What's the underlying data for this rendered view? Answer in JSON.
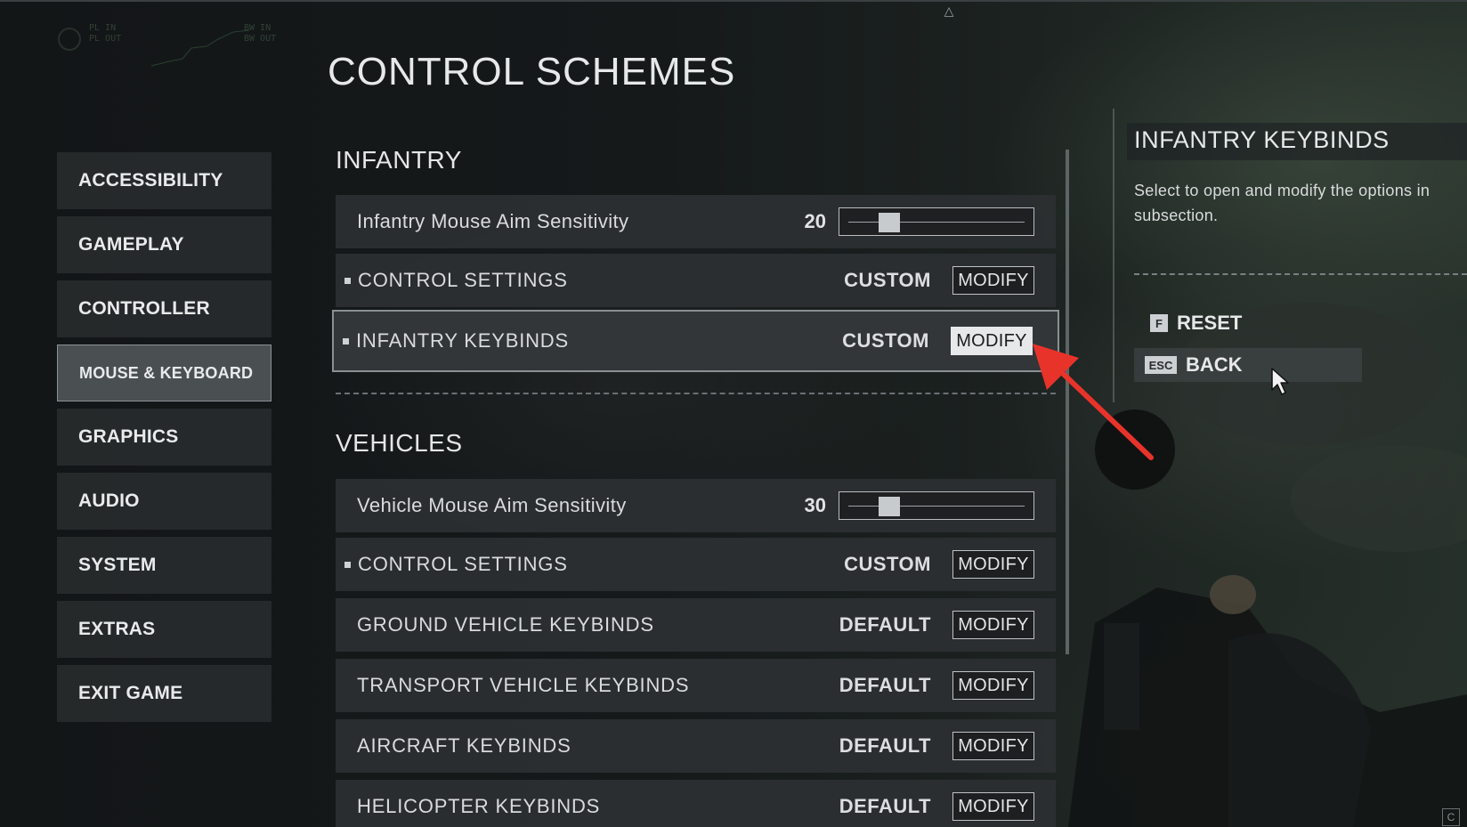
{
  "page": {
    "title": "CONTROL SCHEMES",
    "netgraph": [
      "PL IN",
      "PL OUT",
      "BW IN",
      "BW OUT"
    ]
  },
  "nav": {
    "items": [
      {
        "label": "ACCESSIBILITY",
        "active": false
      },
      {
        "label": "GAMEPLAY",
        "active": false
      },
      {
        "label": "CONTROLLER",
        "active": false
      },
      {
        "label": "MOUSE & KEYBOARD",
        "active": true
      },
      {
        "label": "GRAPHICS",
        "active": false
      },
      {
        "label": "AUDIO",
        "active": false
      },
      {
        "label": "SYSTEM",
        "active": false
      },
      {
        "label": "EXTRAS",
        "active": false
      },
      {
        "label": "EXIT GAME",
        "active": false
      }
    ]
  },
  "infantry": {
    "title": "INFANTRY",
    "sensitivity": {
      "label": "Infantry Mouse Aim Sensitivity",
      "value": "20",
      "level": 0.2
    },
    "control_settings": {
      "label": "CONTROL SETTINGS",
      "value": "CUSTOM",
      "button": "MODIFY"
    },
    "keybinds": {
      "label": "INFANTRY KEYBINDS",
      "value": "CUSTOM",
      "button": "MODIFY"
    }
  },
  "vehicles": {
    "title": "VEHICLES",
    "sensitivity": {
      "label": "Vehicle Mouse Aim Sensitivity",
      "value": "30",
      "level": 0.2
    },
    "control_settings": {
      "label": "CONTROL SETTINGS",
      "value": "CUSTOM",
      "button": "MODIFY"
    },
    "ground": {
      "label": "GROUND VEHICLE KEYBINDS",
      "value": "DEFAULT",
      "button": "MODIFY"
    },
    "transport": {
      "label": "TRANSPORT VEHICLE KEYBINDS",
      "value": "DEFAULT",
      "button": "MODIFY"
    },
    "aircraft": {
      "label": "AIRCRAFT KEYBINDS",
      "value": "DEFAULT",
      "button": "MODIFY"
    },
    "helicopter": {
      "label": "HELICOPTER KEYBINDS",
      "value": "DEFAULT",
      "button": "MODIFY"
    }
  },
  "info": {
    "title": "INFANTRY KEYBINDS",
    "description_line1": "Select to open and modify the options in",
    "description_line2": "subsection.",
    "reset": {
      "key": "F",
      "label": "RESET"
    },
    "back": {
      "key": "ESC",
      "label": "BACK"
    }
  },
  "corner_badge": "C",
  "colors": {
    "annotation_arrow": "#e8332b",
    "highlight_border": "#8a9093"
  }
}
